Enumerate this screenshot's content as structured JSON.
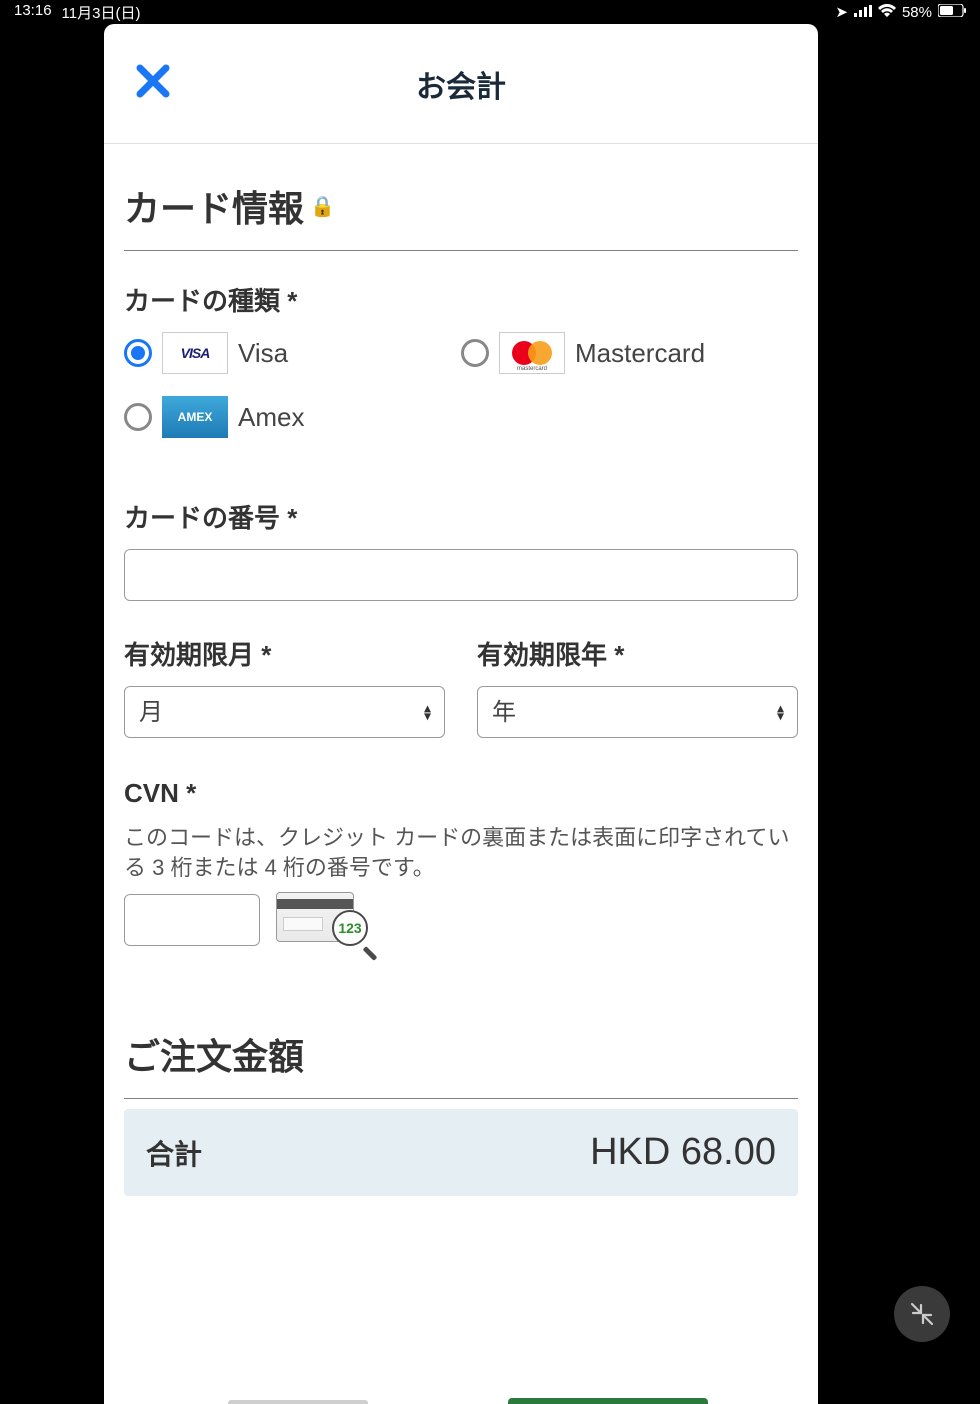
{
  "status_bar": {
    "time": "13:16",
    "date": "11月3日(日)",
    "signal_icon": "signal-icon",
    "wifi_icon": "wifi-icon",
    "battery_percent": "58%",
    "battery_icon": "battery-icon",
    "location_icon": "location-icon"
  },
  "header": {
    "close_label": "✕",
    "title": "お会計"
  },
  "card_info": {
    "heading": "カード情報",
    "lock": "🔒",
    "type_label": "カードの種類 *",
    "options": [
      {
        "value": "visa",
        "label": "Visa",
        "selected": true
      },
      {
        "value": "mastercard",
        "label": "Mastercard",
        "selected": false
      },
      {
        "value": "amex",
        "label": "Amex",
        "selected": false
      }
    ],
    "number_label": "カードの番号 *",
    "number_value": "",
    "exp_month_label": "有効期限月 *",
    "exp_month_placeholder": "月",
    "exp_year_label": "有効期限年 *",
    "exp_year_placeholder": "年",
    "cvn_label": "CVN *",
    "cvn_help": "このコードは、クレジット カードの裏面または表面に印字されている 3 桁または 4 桁の番号です。",
    "cvn_value": "",
    "cvn_illustration_digits": "123"
  },
  "order": {
    "heading": "ご注文金額",
    "total_label": "合計",
    "total_amount": "HKD 68.00"
  }
}
